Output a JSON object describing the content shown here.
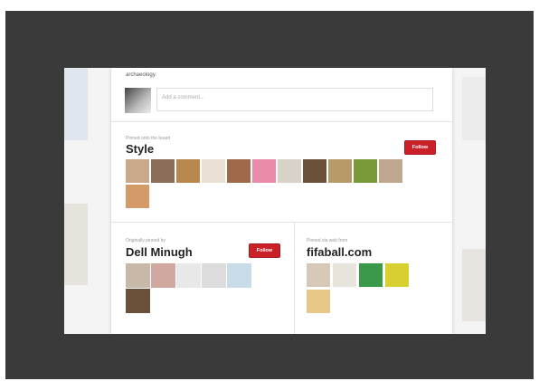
{
  "pin": {
    "description": "archaeology.",
    "comment_placeholder": "Add a comment..."
  },
  "board": {
    "label": "Pinned onto the board",
    "title": "Style",
    "follow_label": "Follow",
    "thumb_colors": [
      "#c9a98a",
      "#8a6e5a",
      "#b8884e",
      "#e8e0d4",
      "#a06a4a",
      "#e88aa8",
      "#d8d2c8",
      "#6a5038",
      "#b89a68",
      "#7a9a3a",
      "#c0a890",
      "#d49a68"
    ]
  },
  "pinner": {
    "label": "Originally pinned by",
    "name": "Dell Minugh",
    "follow_label": "Follow",
    "thumb_colors": [
      "#c8b8a8",
      "#d0a8a0",
      "#e8e8e8",
      "#dcdcdc",
      "#c8dce8",
      "#6a5038"
    ]
  },
  "source": {
    "label": "Pinned via web from",
    "domain": "fifaball.com",
    "thumb_colors": [
      "#d8c8b8",
      "#e8e4dc",
      "#3a9a4a",
      "#d8d030",
      "#e8c888"
    ]
  }
}
